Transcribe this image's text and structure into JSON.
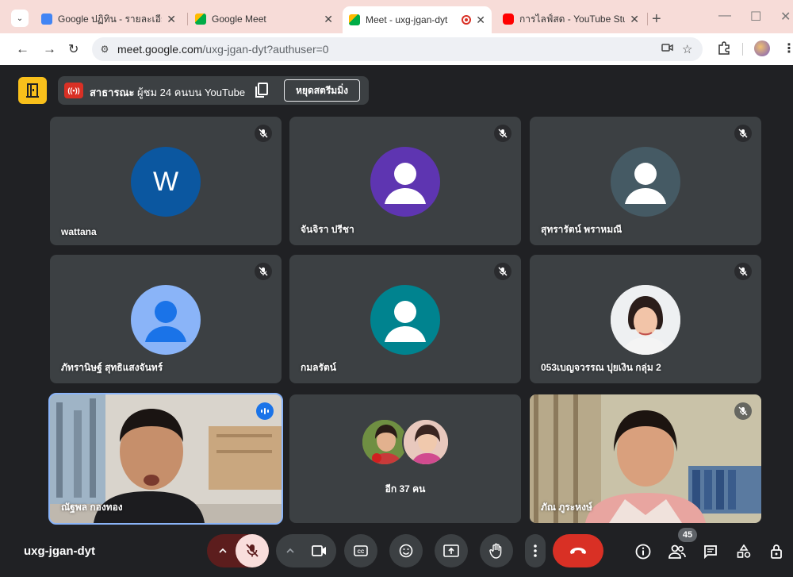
{
  "browser": {
    "tabs": [
      {
        "title": "Google ปฏิทิน - รายละเอียดกิจ",
        "favicon_color": "#4285f4",
        "active": false
      },
      {
        "title": "Google Meet",
        "favicon_color": "#00ac47",
        "active": false
      },
      {
        "title": "Meet - uxg-jgan-dyt",
        "favicon_color": "#00ac47",
        "active": true
      },
      {
        "title": "การไลฟ์สด - YouTube Studio",
        "favicon_color": "#ff0000",
        "active": false
      }
    ],
    "url_host": "meet.google.com",
    "url_path": "/uxg-jgan-dyt?authuser=0"
  },
  "live": {
    "status": "สาธารณะ",
    "viewers": "ผู้ชม 24 คนบน YouTube",
    "stop_label": "หยุดสตรีมมิ่ง",
    "icon_text": "((•))"
  },
  "participants": [
    {
      "name": "wattana",
      "type": "letter",
      "letter": "W",
      "color": "#0b57a0"
    },
    {
      "name": "จันจิรา ปรีชา",
      "type": "person",
      "color": "#5e35b1"
    },
    {
      "name": "สุทรารัตน์ พราหมณี",
      "type": "person",
      "color": "#455a64"
    },
    {
      "name": "ภัทรานิษฐ์ สุทธิแสงจันทร์",
      "type": "person",
      "color": "#8ab4f8"
    },
    {
      "name": "กมลรัตน์",
      "type": "person",
      "color": "#00838f"
    },
    {
      "name": "053เบญจวรรณ ปุยเงิน กลุ่ม 2",
      "type": "photo"
    },
    {
      "name": "ณัฐพล กองทอง",
      "type": "video"
    },
    {
      "name": "อีก 37 คน",
      "type": "group"
    },
    {
      "name": "ภัณ ภูระหงษ์",
      "type": "video"
    }
  ],
  "meeting_code": "uxg-jgan-dyt",
  "people_count": "45",
  "colors": {
    "accent": "#1a73e8",
    "leave": "#d93025",
    "host": "#f9c01b"
  }
}
